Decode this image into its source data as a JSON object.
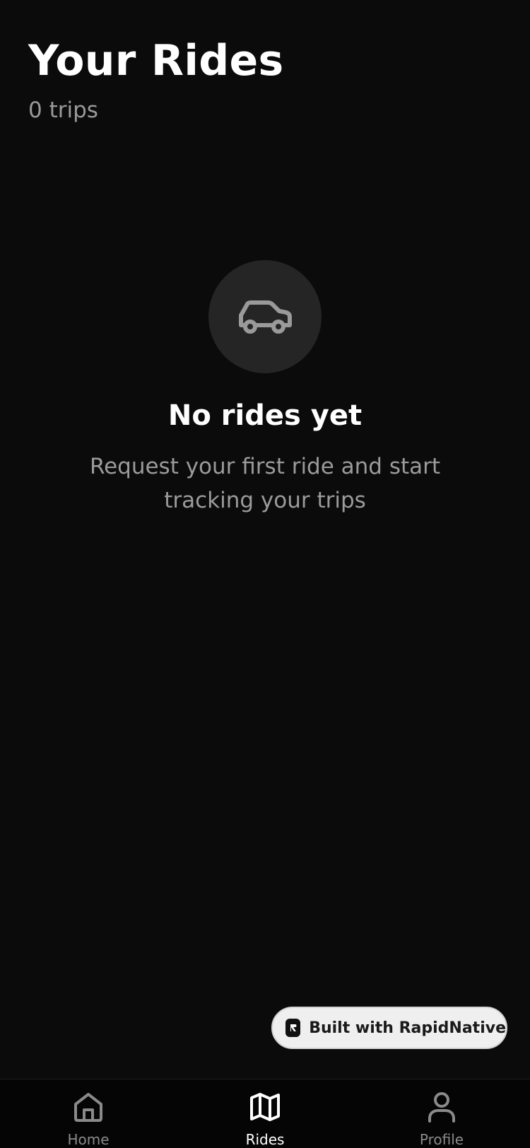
{
  "header": {
    "title": "Your Rides",
    "trip_count": "0 trips"
  },
  "empty_state": {
    "icon": "car-icon",
    "title": "No rides yet",
    "description": "Request your first ride and start tracking your trips"
  },
  "badge": {
    "label": "Built with RapidNative",
    "icon": "rapidnative-logo-icon"
  },
  "tabs": [
    {
      "label": "Home",
      "icon": "home-icon",
      "active": false
    },
    {
      "label": "Rides",
      "icon": "map-icon",
      "active": true
    },
    {
      "label": "Profile",
      "icon": "user-icon",
      "active": false
    }
  ],
  "colors": {
    "background": "#0b0b0b",
    "icon_circle": "#252525",
    "muted_text": "#9a9a9a",
    "active_tab": "#ffffff",
    "inactive_tab": "#8a8a8a"
  }
}
